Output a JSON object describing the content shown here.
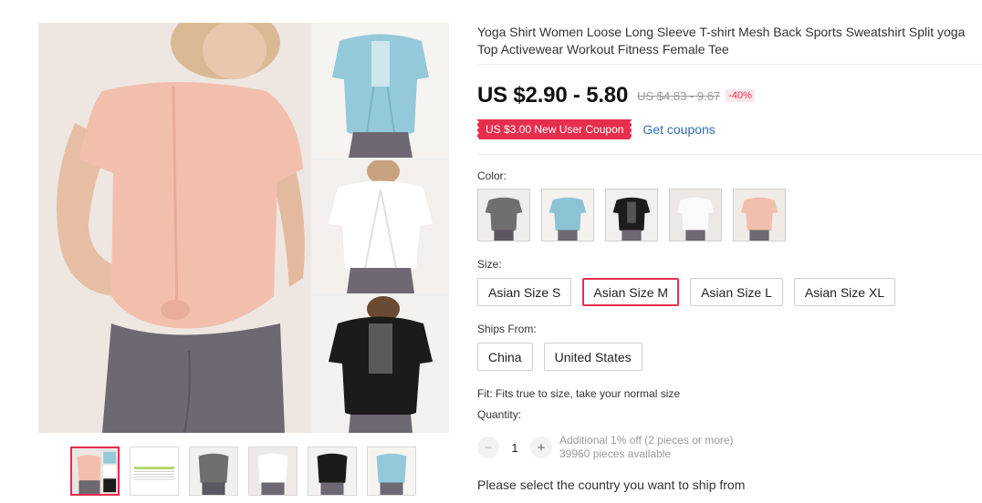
{
  "product": {
    "title": "Yoga Shirt Women Loose Long Sleeve T-shirt Mesh Back Sports Sweatshirt Split yoga Top Activewear Workout Fitness Female Tee",
    "price": "US $2.90 - 5.80",
    "original_price": "US $4.83 - 9.67",
    "discount": "-40%"
  },
  "coupon": {
    "badge": "US $3.00 New User Coupon",
    "link": "Get coupons"
  },
  "color": {
    "label": "Color:",
    "swatches": [
      {
        "icon": "shirt-gray",
        "color": "#6f6f6f"
      },
      {
        "icon": "shirt-blue",
        "color": "#8cc3d3"
      },
      {
        "icon": "shirt-black",
        "color": "#1c1c1c"
      },
      {
        "icon": "shirt-white",
        "color": "#f4f4f4"
      },
      {
        "icon": "shirt-pink",
        "color": "#f0bfae"
      }
    ]
  },
  "size": {
    "label": "Size:",
    "options": [
      "Asian Size S",
      "Asian Size M",
      "Asian Size L",
      "Asian Size XL"
    ],
    "selected": "Asian Size M"
  },
  "ships_from": {
    "label": "Ships From:",
    "options": [
      "China",
      "United States"
    ]
  },
  "fit": "Fit: Fits true to size, take your normal size",
  "quantity": {
    "label": "Quantity:",
    "minus": "−",
    "value": "1",
    "plus": "+",
    "note1": "Additional 1% off (2 pieces or more)",
    "note2": "39960 pieces available"
  },
  "shipping_note": "Please select the country you want to ship from",
  "colors": {
    "accent": "#e62e4d",
    "link": "#2e6db5",
    "skin": "#e9c4ad",
    "legging": "#6b6670"
  }
}
